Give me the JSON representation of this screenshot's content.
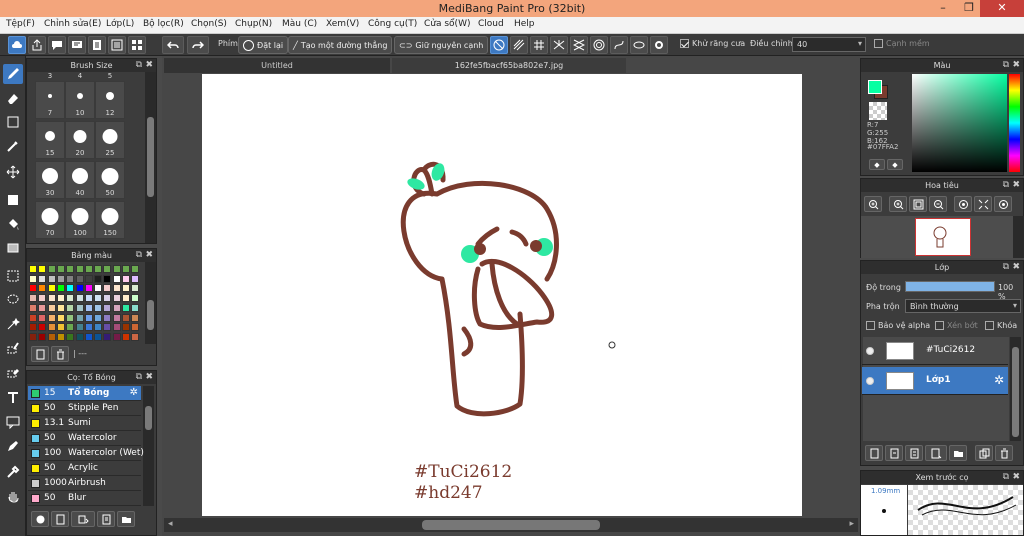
{
  "window": {
    "title": "MediBang Paint Pro (32bit)",
    "minimize": "–",
    "maximize": "❐",
    "close": "✕"
  },
  "menu": [
    "Tệp(F)",
    "Chỉnh sửa(E)",
    "Lớp(L)",
    "Bộ lọc(R)",
    "Chọn(S)",
    "Chụp(N)",
    "Màu (C)",
    "Xem(V)",
    "Công cụ(T)",
    "Cửa sổ(W)",
    "Cloud",
    "Help"
  ],
  "toolbar": {
    "phim_label": "Phím",
    "reset_label": "Đặt lại",
    "straight_line_label": "Tạo một đường thẳng",
    "keep_edge_label": "Giữ nguyên cạnh",
    "antialias_label": "Khử răng cưa",
    "antialias_checked": true,
    "adjust_label": "Điều chỉnh",
    "adjust_value": "40",
    "smooth_label": "Cạnh mềm",
    "smooth_checked": false
  },
  "brush_size": {
    "title": "Brush Size",
    "top_row": [
      "3",
      "4",
      "5"
    ],
    "sizes": [
      "7",
      "10",
      "12",
      "15",
      "20",
      "25",
      "30",
      "40",
      "50",
      "70",
      "100",
      "150"
    ]
  },
  "palette": {
    "title": "Bảng màu",
    "extra_label": "| ---",
    "colors": [
      "#ffff00",
      "#ffff00",
      "#6aa84f",
      "#6aa84f",
      "#6aa84f",
      "#6aa84f",
      "#6aa84f",
      "#6aa84f",
      "#6aa84f",
      "#6aa84f",
      "#6aa84f",
      "#6aa84f",
      "#ffffcc",
      "#e0e0e0",
      "#c0c0c0",
      "#a0a0a0",
      "#808080",
      "#606060",
      "#404040",
      "#202020",
      "#000000",
      "#ffffff",
      "#ffccee",
      "#ddbbff",
      "#ff0000",
      "#ff8800",
      "#ffff00",
      "#00ff00",
      "#00ffff",
      "#0000ff",
      "#ff00ff",
      "#ffffff",
      "#f4cccc",
      "#fce5cd",
      "#fff2cc",
      "#d9ead3",
      "#e6b8af",
      "#f4cccc",
      "#fce5cd",
      "#fff2cc",
      "#d9ead3",
      "#d0e0e3",
      "#c9daf8",
      "#cfe2f3",
      "#d9d2e9",
      "#ead1dc",
      "#ffeecc",
      "#ccffcc",
      "#dd7e6b",
      "#ea9999",
      "#f9cb9c",
      "#ffe599",
      "#b6d7a8",
      "#a2c4c9",
      "#a4c2f4",
      "#9fc5e8",
      "#b4a7d6",
      "#d5a6bd",
      "#2ee8a2",
      "#88ddcc",
      "#cc4125",
      "#e06666",
      "#f6b26b",
      "#ffd966",
      "#93c47d",
      "#76a5af",
      "#6d9eeb",
      "#6fa8dc",
      "#8e7cc3",
      "#c27ba0",
      "#aa5533",
      "#cc8855",
      "#a61c00",
      "#cc0000",
      "#e69138",
      "#f1c232",
      "#6aa84f",
      "#45818e",
      "#3c78d8",
      "#3d85c6",
      "#674ea7",
      "#a64d79",
      "#993300",
      "#cc6633",
      "#85200c",
      "#990000",
      "#b45f06",
      "#bf9000",
      "#38761d",
      "#134f5c",
      "#1155cc",
      "#0b5394",
      "#351c75",
      "#741b47",
      "#cc3300",
      "#cc6644"
    ]
  },
  "brushes": {
    "title": "Cọ: Tổ Bóng",
    "items": [
      {
        "size": "15",
        "name": "Tổ Bóng",
        "color": "#2ecc71",
        "selected": true
      },
      {
        "size": "50",
        "name": "Stipple Pen",
        "color": "#ffee00",
        "selected": false
      },
      {
        "size": "13.1",
        "name": "Sumi",
        "color": "#ffee00",
        "selected": false
      },
      {
        "size": "50",
        "name": "Watercolor",
        "color": "#66ccee",
        "selected": false
      },
      {
        "size": "100",
        "name": "Watercolor (Wet)",
        "color": "#66ccee",
        "selected": false
      },
      {
        "size": "50",
        "name": "Acrylic",
        "color": "#ffee00",
        "selected": false
      },
      {
        "size": "1000",
        "name": "Airbrush",
        "color": "#cccccc",
        "selected": false
      },
      {
        "size": "50",
        "name": "Blur",
        "color": "#ffaacc",
        "selected": false
      }
    ]
  },
  "tabs": [
    "Untitled",
    "162fe5fbacf65ba802e7.jpg"
  ],
  "canvas": {
    "hashtag1": "#TuCi2612",
    "hashtag2": "#hd247"
  },
  "color_panel": {
    "title": "Màu",
    "r": "R:7",
    "g": "G:255",
    "b": "B:162",
    "hex": "#07FFA2",
    "foreground": "#07ffa2",
    "background": "#7a3b2e"
  },
  "navigator": {
    "title": "Hoa tiêu"
  },
  "layer_panel": {
    "title": "Lớp",
    "opacity_label": "Độ trong",
    "opacity_value": "100 %",
    "opacity_fraction": 1.0,
    "blend_label": "Pha trộn",
    "blend_value": "Bình thường",
    "protect_alpha": "Bảo vệ alpha",
    "clipping": "Xén bớt",
    "lock": "Khóa",
    "layers": [
      {
        "name": "#TuCi2612",
        "selected": false
      },
      {
        "name": "Lớp1",
        "selected": true
      }
    ]
  },
  "preview": {
    "title": "Xem trước cọ",
    "size_label": "1.09mm"
  }
}
